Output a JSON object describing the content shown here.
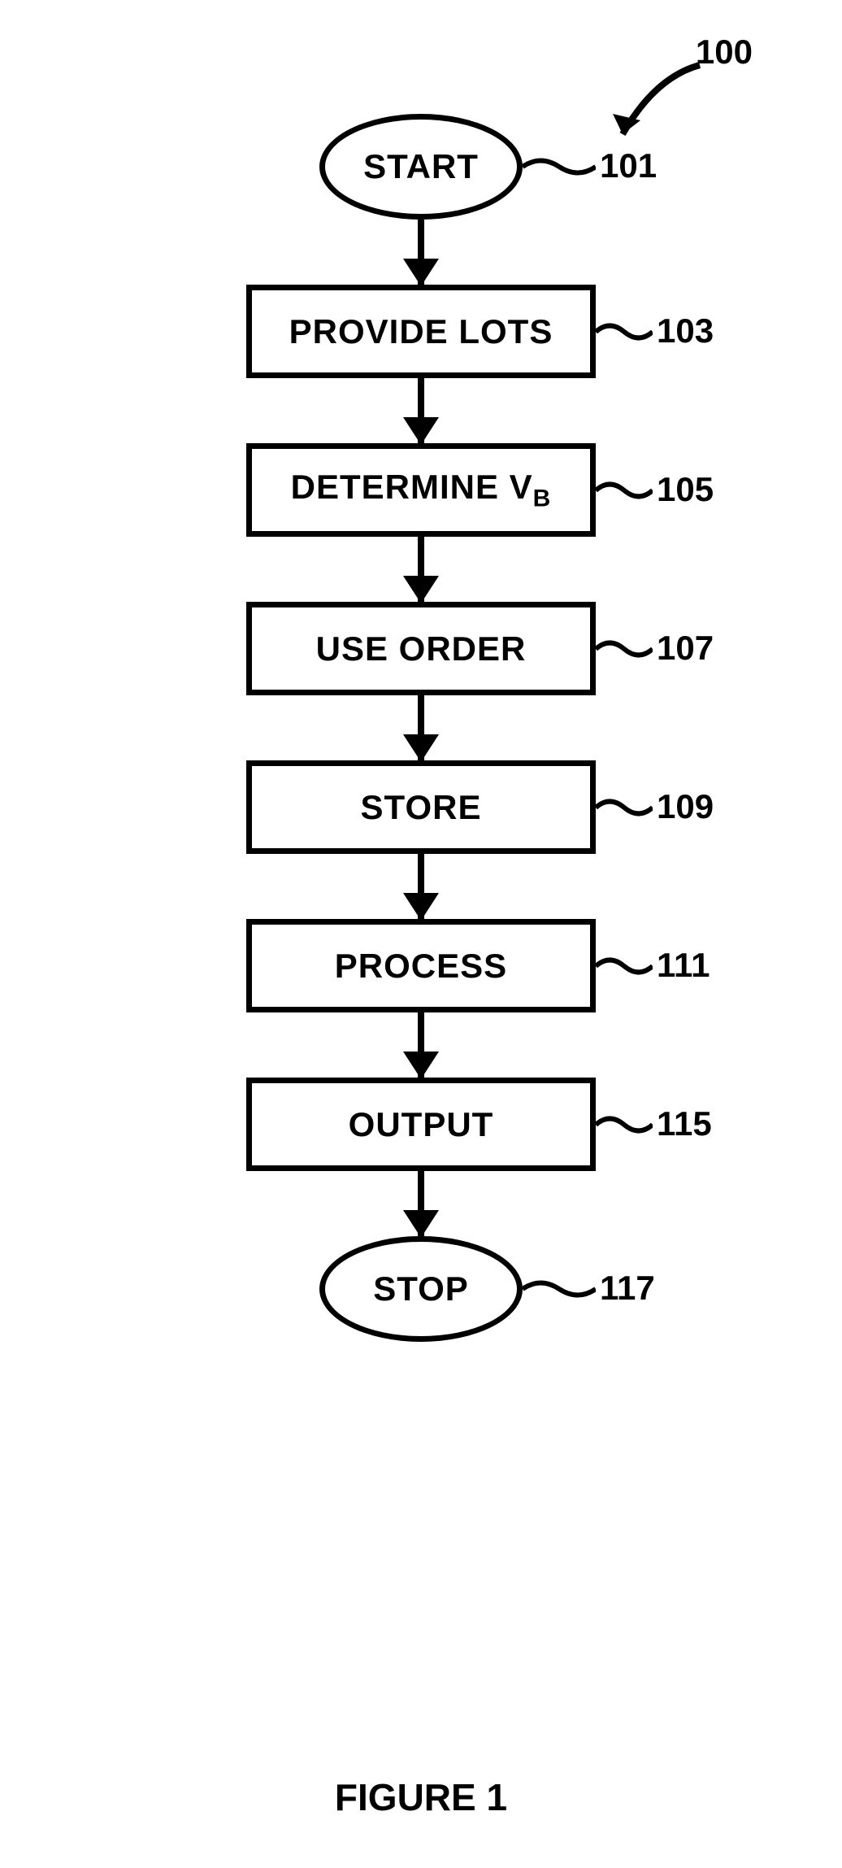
{
  "caption": "FIGURE 1",
  "overall_ref": "100",
  "chart_data": {
    "type": "flowchart",
    "direction": "top-down",
    "nodes": [
      {
        "id": "101",
        "shape": "terminator",
        "label": "START"
      },
      {
        "id": "103",
        "shape": "process",
        "label": "PROVIDE LOTS"
      },
      {
        "id": "105",
        "shape": "process",
        "label": "DETERMINE V_B"
      },
      {
        "id": "107",
        "shape": "process",
        "label": "USE ORDER"
      },
      {
        "id": "109",
        "shape": "process",
        "label": "STORE"
      },
      {
        "id": "111",
        "shape": "process",
        "label": "PROCESS"
      },
      {
        "id": "115",
        "shape": "process",
        "label": "OUTPUT"
      },
      {
        "id": "117",
        "shape": "terminator",
        "label": "STOP"
      }
    ],
    "edges": [
      [
        "101",
        "103"
      ],
      [
        "103",
        "105"
      ],
      [
        "105",
        "107"
      ],
      [
        "107",
        "109"
      ],
      [
        "109",
        "111"
      ],
      [
        "111",
        "115"
      ],
      [
        "115",
        "117"
      ]
    ],
    "diagram_ref": "100"
  },
  "nodes": {
    "n101": {
      "label": "START",
      "ref": "101"
    },
    "n103": {
      "label": "PROVIDE LOTS",
      "ref": "103"
    },
    "n105": {
      "label_html": "DETERMINE V<sub>B</sub>",
      "label": "DETERMINE V_B",
      "ref": "105"
    },
    "n107": {
      "label": "USE ORDER",
      "ref": "107"
    },
    "n109": {
      "label": "STORE",
      "ref": "109"
    },
    "n111": {
      "label": "PROCESS",
      "ref": "111"
    },
    "n115": {
      "label": "OUTPUT",
      "ref": "115"
    },
    "n117": {
      "label": "STOP",
      "ref": "117"
    }
  }
}
